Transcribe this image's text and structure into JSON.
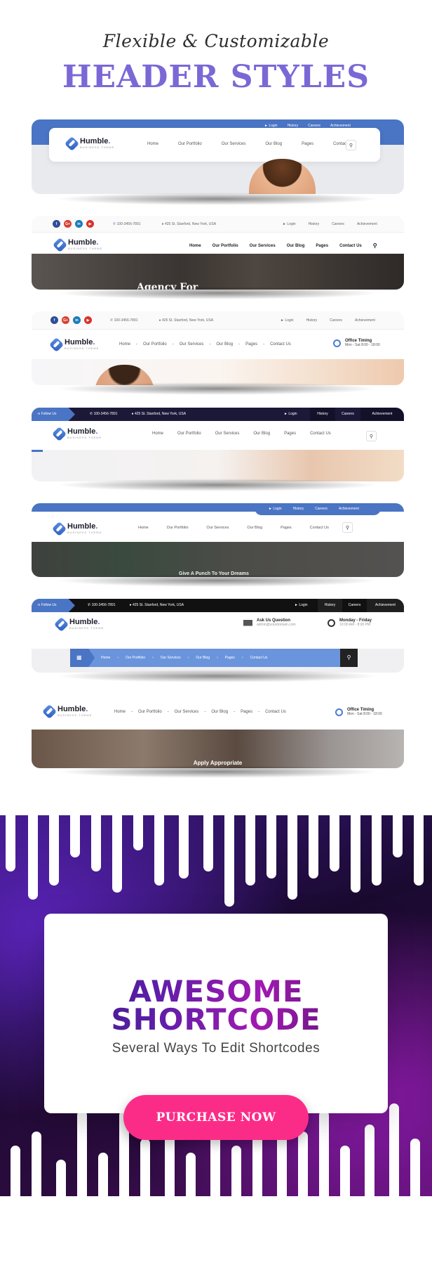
{
  "hero": {
    "subtitle": "Flexible & Customizable",
    "title": "HEADER STYLES"
  },
  "brand": {
    "name": "Humble",
    "dot": ".",
    "tagline": "BUSINESS THEME",
    "accent_color": "#4a74c4",
    "title_color": "#7b68d6",
    "purchase_color": "#fb2c88"
  },
  "nav_items": [
    "Home",
    "Our Portfolio",
    "Our Services",
    "Our Blog",
    "Pages",
    "Contact Us"
  ],
  "top_links": {
    "login": "Login",
    "history": "History",
    "careers": "Careers",
    "achievement": "Achievement"
  },
  "contact": {
    "phone": "100-3456-7891",
    "address": "425 St. Stanford, New York, USA",
    "follow_us": "Follow Us"
  },
  "social": [
    {
      "name": "facebook",
      "glyph": "f",
      "color": "#2f4e95"
    },
    {
      "name": "google-plus",
      "glyph": "G+",
      "color": "#d8412f"
    },
    {
      "name": "linkedin",
      "glyph": "in",
      "color": "#1a7bb9"
    },
    {
      "name": "youtube",
      "glyph": "▶",
      "color": "#d8342a"
    }
  ],
  "office_timing": {
    "title": "Office Timing",
    "value": "Mon - Sat 8:00 - 18:00"
  },
  "ask_question": {
    "title": "Ask Us Question",
    "value": "admin@yourdomain.com"
  },
  "weekday_hours": {
    "title": "Monday - Friday",
    "value": "10:00 AM - 8:00 PM"
  },
  "hero_captions": {
    "header2": "Agency For",
    "header5": "Give A Punch To Your Dreams",
    "header7": "Apply Appropriate"
  },
  "promo": {
    "title_line1": "AWESOME",
    "title_line2": "SHORTCODE",
    "subtitle": "Several Ways To Edit Shortcodes",
    "button": "PURCHASE NOW"
  }
}
